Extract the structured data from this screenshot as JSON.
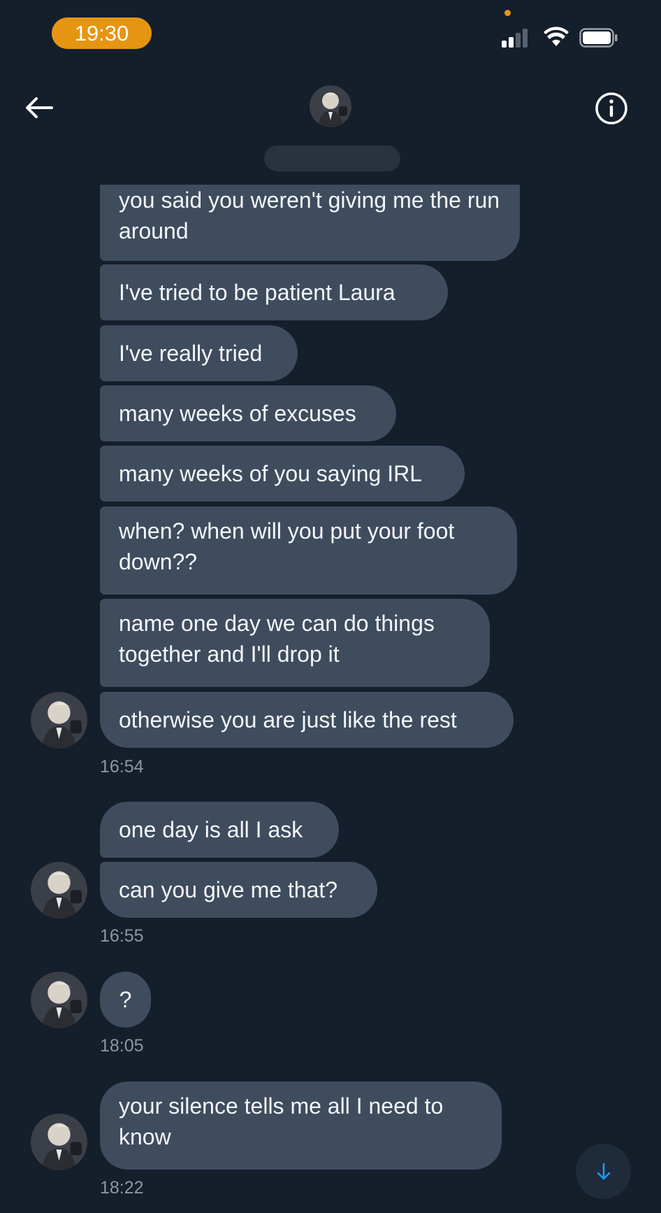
{
  "status_bar": {
    "time": "19:30"
  },
  "header": {
    "back_icon": "arrow-left-icon",
    "info_icon": "info-circle-icon"
  },
  "messages": [
    {
      "text": "you said you weren't giving me the run around"
    },
    {
      "text": "I've tried to be patient Laura"
    },
    {
      "text": "I've really tried"
    },
    {
      "text": "many weeks of excuses"
    },
    {
      "text": "many weeks of you saying IRL"
    },
    {
      "text": "when? when will you put your foot down??"
    },
    {
      "text": "name one day we can do things together and I'll drop it"
    },
    {
      "text": "otherwise you are just like the rest"
    },
    {
      "text": "one day is all I ask"
    },
    {
      "text": "can you give me that?"
    },
    {
      "text": "?"
    },
    {
      "text": "your silence tells me all I need to know"
    }
  ],
  "timestamps": [
    "16:54",
    "16:55",
    "18:05",
    "18:22"
  ],
  "colors": {
    "background": "#151e2b",
    "bubble": "#3e4c5e",
    "time_pill": "#e69512",
    "timestamp_text": "#8b97a4",
    "accent_blue": "#1d9bf0"
  }
}
